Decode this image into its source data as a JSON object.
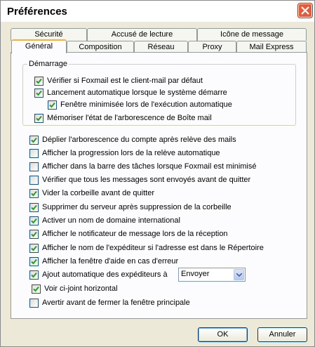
{
  "window": {
    "title": "Préférences"
  },
  "tabs_row1": [
    "Sécurité",
    "Accusé de lecture",
    "Icône de message"
  ],
  "tabs_row2": [
    "Général",
    "Composition",
    "Réseau",
    "Proxy",
    "Mail Express"
  ],
  "active_tab": "Général",
  "startup_group": {
    "label": "Démarrage",
    "items": [
      {
        "label": "Vérifier si Foxmail est le client-mail par défaut",
        "checked": true
      },
      {
        "label": "Lancement automatique lorsque le système démarre",
        "checked": true
      },
      {
        "label": "Fenêtre minimisée lors de l'exécution automatique",
        "checked": true
      },
      {
        "label": "Mémoriser l'état de l'arborescence de Boîte mail",
        "checked": true
      }
    ]
  },
  "options": [
    {
      "label": "Déplier l'arborescence du compte après relève des mails",
      "checked": true
    },
    {
      "label": "Afficher la progression lors de la relève automatique",
      "checked": false
    },
    {
      "label": "Afficher dans la barre des tâches lorsque Foxmail est minimisé",
      "checked": false
    },
    {
      "label": "Vérifier que tous les messages sont envoyés avant de quitter",
      "checked": false
    },
    {
      "label": "Vider la corbeille avant de quitter",
      "checked": true
    },
    {
      "label": "Supprimer du serveur après suppression de la corbeille",
      "checked": true
    },
    {
      "label": "Activer un nom de domaine international",
      "checked": true
    },
    {
      "label": "Afficher le notificateur de message lors de la réception",
      "checked": true
    },
    {
      "label": "Afficher le nom de l'expéditeur si l'adresse est dans le Répertoire",
      "checked": true
    },
    {
      "label": "Afficher la fenêtre d'aide en cas d'erreur",
      "checked": true
    },
    {
      "label": "Ajout automatique des expéditeurs à",
      "checked": true
    },
    {
      "label": "Voir ci-joint horizontal",
      "checked": true
    },
    {
      "label": "Avertir avant de fermer la fenêtre principale",
      "checked": false
    }
  ],
  "auto_add_select": {
    "value": "Envoyer"
  },
  "buttons": {
    "ok": "OK",
    "cancel": "Annuler"
  },
  "colors": {
    "active_tab_accent": "#f7b132",
    "close_button": "#e45a3a",
    "dialog_bg": "#ece9d8"
  }
}
